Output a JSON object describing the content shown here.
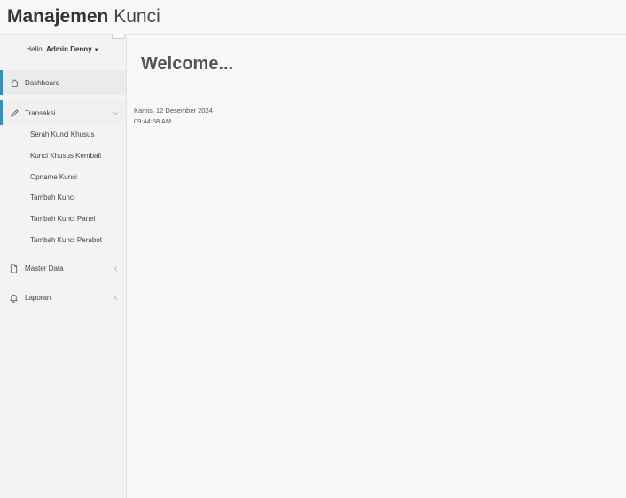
{
  "brand": {
    "strong": "Manajemen",
    "light": "Kunci"
  },
  "user": {
    "greeting": "Hello,",
    "name": "Admin Denny"
  },
  "sidebar": {
    "items": [
      {
        "label": "Dashboard",
        "icon": "home-icon"
      },
      {
        "label": "Transaksi",
        "icon": "pencil-icon",
        "expanded": true,
        "children": [
          "Serah Kunci Khusus",
          "Kunci Khusus Kembali",
          "Opname Kunci",
          "Tambah Kunci",
          "Tambah Kunci Panel",
          "Tambah Kunci Perabot"
        ]
      },
      {
        "label": "Master Data",
        "icon": "file-icon"
      },
      {
        "label": "Laporan",
        "icon": "bell-icon"
      }
    ]
  },
  "main": {
    "heading": "Welcome...",
    "date": "Kamis, 12 Desember 2024",
    "time": "09:44:58 AM"
  },
  "colors": {
    "accent": "#3c8dbc",
    "background": "#f8f8f8",
    "sidebar": "#f3f3f3"
  }
}
